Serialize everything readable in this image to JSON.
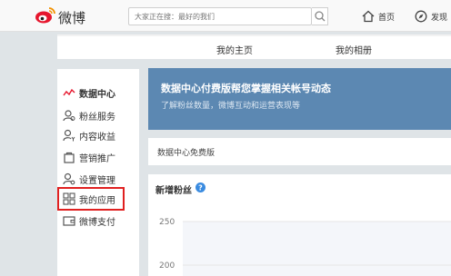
{
  "header": {
    "brand": "微博",
    "search_placeholder": "大家正在搜：最好的我们",
    "nav_home": "首页",
    "nav_discover": "发现"
  },
  "tabs": [
    "我的主页",
    "我的相册"
  ],
  "sidebar": {
    "items": [
      {
        "label": "数据中心",
        "icon": "line-chart-icon",
        "active": true
      },
      {
        "label": "粉丝服务",
        "icon": "fans-icon"
      },
      {
        "label": "内容收益",
        "icon": "user-yen-icon"
      },
      {
        "label": "营销推广",
        "icon": "bag-icon"
      },
      {
        "label": "设置管理",
        "icon": "user-gear-icon"
      },
      {
        "label": "我的应用",
        "icon": "apps-grid-icon",
        "highlighted": true
      },
      {
        "label": "微博支付",
        "icon": "wallet-icon"
      }
    ]
  },
  "banner": {
    "title": "数据中心付费版帮您掌握相关帐号动态",
    "subtitle": "了解粉丝数量，微博互动和运营表现等"
  },
  "version_label": "数据中心免费版",
  "chart_card": {
    "title": "新增粉丝"
  },
  "chart_data": {
    "type": "line",
    "title": "",
    "yticks": [
      250,
      200
    ],
    "series": []
  },
  "colors": {
    "banner": "#5c88b2",
    "highlight": "#e02020",
    "brand_red": "#e6162d",
    "help_blue": "#3a8be0"
  }
}
